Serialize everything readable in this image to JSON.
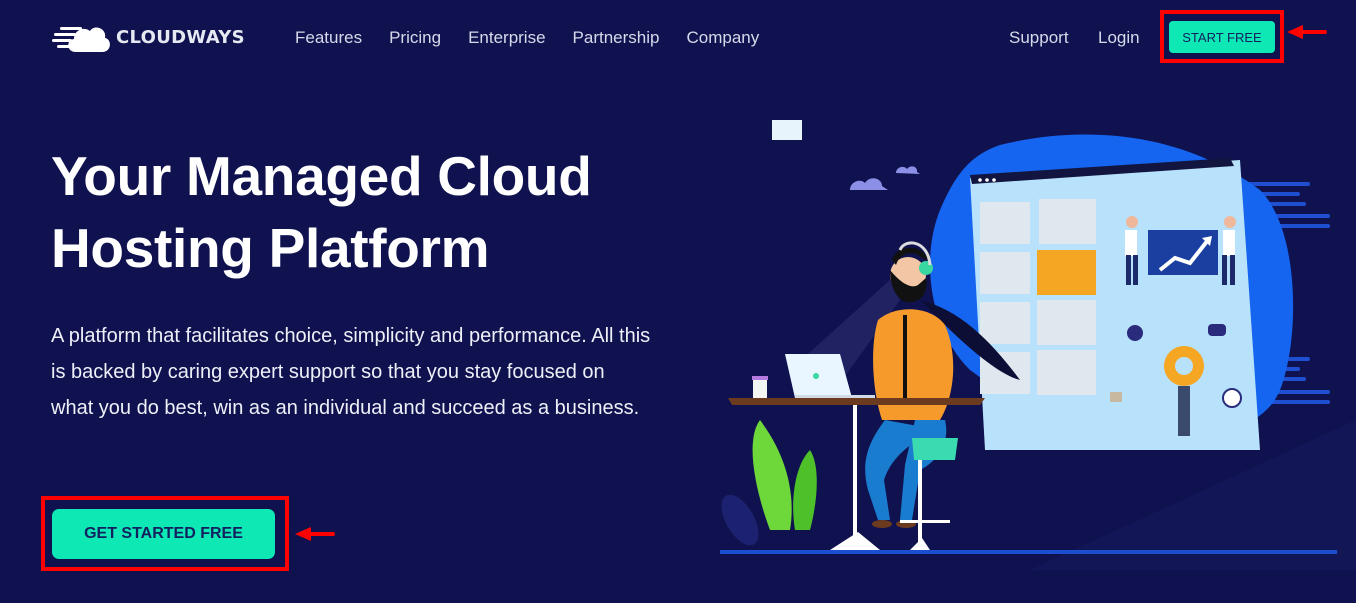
{
  "header": {
    "logo_text": "CLOUDWAYS",
    "nav": [
      {
        "label": "Features"
      },
      {
        "label": "Pricing"
      },
      {
        "label": "Enterprise"
      },
      {
        "label": "Partnership"
      },
      {
        "label": "Company"
      }
    ],
    "support_label": "Support",
    "login_label": "Login",
    "start_free_label": "START FREE"
  },
  "hero": {
    "title_line1": "Your Managed Cloud",
    "title_line2": "Hosting Platform",
    "description": "A platform that facilitates choice, simplicity and performance. All this is backed by caring expert support so that you stay focused on what you do best, win as an individual and succeed as a business.",
    "cta_label": "GET STARTED FREE"
  },
  "colors": {
    "background": "#10124f",
    "accent_green": "#0de8b4",
    "button_text": "#13205f",
    "annotation_red": "#ff0000",
    "blob_blue": "#1565f0"
  },
  "icons": {
    "logo": "cloud-speed-icon",
    "annotation": "red-arrow-icon",
    "illustration": "support-agent-illustration"
  }
}
